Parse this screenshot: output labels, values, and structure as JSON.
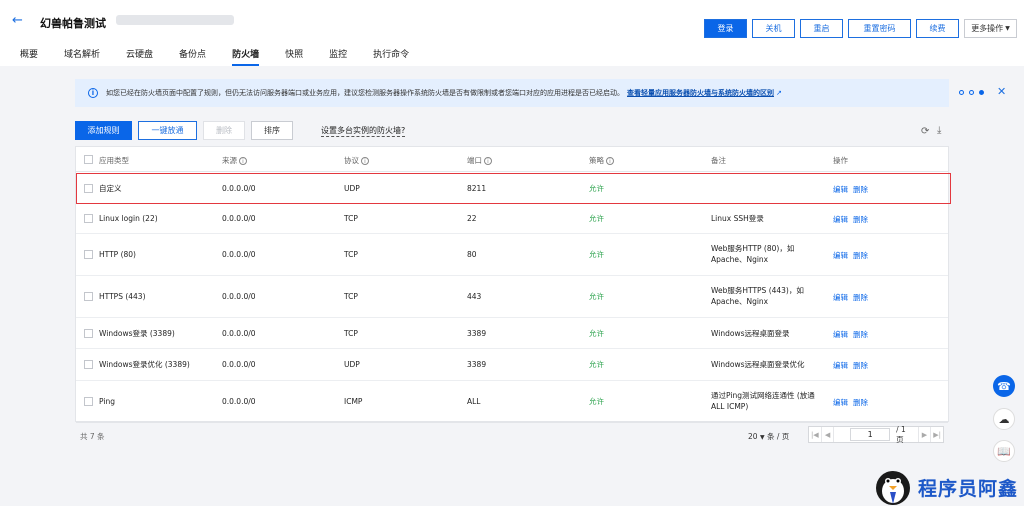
{
  "header": {
    "title": "幻兽帕鲁测试",
    "buttons": [
      "登录",
      "关机",
      "重启",
      "重置密码",
      "续费",
      "更多操作"
    ]
  },
  "tabs": [
    "概要",
    "域名解析",
    "云硬盘",
    "备份点",
    "防火墙",
    "快照",
    "监控",
    "执行命令"
  ],
  "notice": {
    "text": "如您已经在防火墙页面中配置了规则，但仍无法访问服务器端口或业务应用，建议您检测服务器操作系统防火墙是否有做限制或者您端口对应的应用进程是否已经启动。",
    "link": "查看轻量应用服务器防火墙与系统防火墙的区别"
  },
  "toolbar": {
    "add_rule": "添加规则",
    "one_click": "一键放通",
    "delete": "删除",
    "sort": "排序",
    "multi_instance": "设置多台实例的防火墙?"
  },
  "table": {
    "headers": [
      "应用类型",
      "来源",
      "协议",
      "端口",
      "策略",
      "备注",
      "操作"
    ],
    "edit_label": "编辑",
    "delete_label": "删除",
    "rows": [
      {
        "app": "自定义",
        "source": "0.0.0.0/0",
        "protocol": "UDP",
        "port": "8211",
        "policy": "允许",
        "note1": "",
        "note2": ""
      },
      {
        "app": "Linux login (22)",
        "source": "0.0.0.0/0",
        "protocol": "TCP",
        "port": "22",
        "policy": "允许",
        "note1": "Linux SSH登录",
        "note2": ""
      },
      {
        "app": "HTTP (80)",
        "source": "0.0.0.0/0",
        "protocol": "TCP",
        "port": "80",
        "policy": "允许",
        "note1": "Web服务HTTP (80)，如",
        "note2": "Apache、Nginx"
      },
      {
        "app": "HTTPS (443)",
        "source": "0.0.0.0/0",
        "protocol": "TCP",
        "port": "443",
        "policy": "允许",
        "note1": "Web服务HTTPS (443)，如",
        "note2": "Apache、Nginx"
      },
      {
        "app": "Windows登录 (3389)",
        "source": "0.0.0.0/0",
        "protocol": "TCP",
        "port": "3389",
        "policy": "允许",
        "note1": "Windows远程桌面登录",
        "note2": ""
      },
      {
        "app": "Windows登录优化 (3389)",
        "source": "0.0.0.0/0",
        "protocol": "UDP",
        "port": "3389",
        "policy": "允许",
        "note1": "Windows远程桌面登录优化",
        "note2": ""
      },
      {
        "app": "Ping",
        "source": "0.0.0.0/0",
        "protocol": "ICMP",
        "port": "ALL",
        "policy": "允许",
        "note1": "通过Ping测试网络连通性 (放通",
        "note2": "ALL ICMP)"
      }
    ]
  },
  "footer": {
    "total": "共 7 条",
    "page_size": "20",
    "per_page": "条 / 页",
    "page": "1",
    "page_total": "/ 1 页"
  },
  "watermark": "程序员阿鑫",
  "colors": {
    "primary": "#0a66e8",
    "allow": "#2ba24c",
    "highlight": "#e3383f"
  }
}
